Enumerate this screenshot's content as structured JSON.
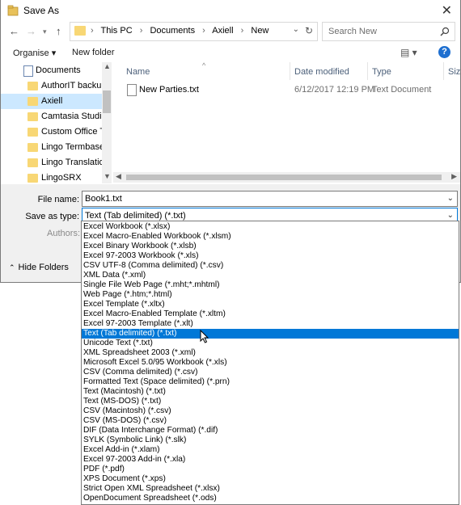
{
  "window": {
    "title": "Save As"
  },
  "breadcrumb": [
    "This PC",
    "Documents",
    "Axiell",
    "New"
  ],
  "search": {
    "placeholder": "Search New"
  },
  "toolbar": {
    "organise": "Organise ▾",
    "new_folder": "New folder"
  },
  "nav": {
    "root": "Documents",
    "items": [
      {
        "label": "AuthorIT backup"
      },
      {
        "label": "Axiell",
        "selected": true
      },
      {
        "label": "Camtasia Studio"
      },
      {
        "label": "Custom Office Te"
      },
      {
        "label": "Lingo Termbases"
      },
      {
        "label": "Lingo Translation"
      },
      {
        "label": "LingoSRX"
      }
    ]
  },
  "columns": {
    "name": "Name",
    "date": "Date modified",
    "type": "Type",
    "size": "Size"
  },
  "files": [
    {
      "name": "New Parties.txt",
      "date": "6/12/2017 12:19 PM",
      "type": "Text Document"
    }
  ],
  "form": {
    "file_name_label": "File name:",
    "file_name_value": "Book1.txt",
    "save_type_label": "Save as type:",
    "save_type_value": "Text (Tab delimited) (*.txt)",
    "authors_label": "Authors:",
    "hide_folders": "Hide Folders"
  },
  "file_types": [
    "Excel Workbook (*.xlsx)",
    "Excel Macro-Enabled Workbook (*.xlsm)",
    "Excel Binary Workbook (*.xlsb)",
    "Excel 97-2003 Workbook (*.xls)",
    "CSV UTF-8 (Comma delimited) (*.csv)",
    "XML Data (*.xml)",
    "Single File Web Page (*.mht;*.mhtml)",
    "Web Page (*.htm;*.html)",
    "Excel Template (*.xltx)",
    "Excel Macro-Enabled Template (*.xltm)",
    "Excel 97-2003 Template (*.xlt)",
    "Text (Tab delimited) (*.txt)",
    "Unicode Text (*.txt)",
    "XML Spreadsheet 2003 (*.xml)",
    "Microsoft Excel 5.0/95 Workbook (*.xls)",
    "CSV (Comma delimited) (*.csv)",
    "Formatted Text (Space delimited) (*.prn)",
    "Text (Macintosh) (*.txt)",
    "Text (MS-DOS) (*.txt)",
    "CSV (Macintosh) (*.csv)",
    "CSV (MS-DOS) (*.csv)",
    "DIF (Data Interchange Format) (*.dif)",
    "SYLK (Symbolic Link) (*.slk)",
    "Excel Add-in (*.xlam)",
    "Excel 97-2003 Add-in (*.xla)",
    "PDF (*.pdf)",
    "XPS Document (*.xps)",
    "Strict Open XML Spreadsheet (*.xlsx)",
    "OpenDocument Spreadsheet (*.ods)"
  ],
  "selected_type_index": 11,
  "colors": {
    "accent": "#0078d7",
    "folder": "#f8d775",
    "selected_nav": "#cce8ff"
  }
}
